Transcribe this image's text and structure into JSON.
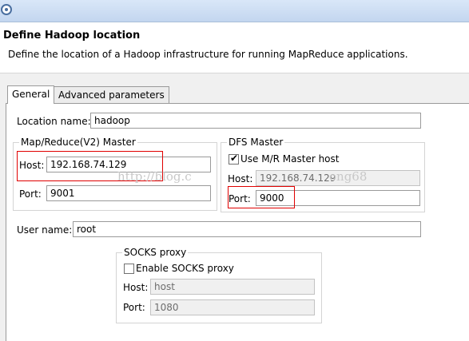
{
  "header": {
    "title": "Define Hadoop location",
    "description": "Define the location of a Hadoop infrastructure for running MapReduce applications."
  },
  "tabs": [
    {
      "label": "General",
      "active": true
    },
    {
      "label": "Advanced parameters",
      "active": false
    }
  ],
  "general": {
    "location_name_label": "Location name:",
    "location_name_value": "hadoop",
    "mapreduce": {
      "title": "Map/Reduce(V2) Master",
      "host_label": "Host:",
      "host_value": "192.168.74.129",
      "port_label": "Port:",
      "port_value": "9001"
    },
    "dfs": {
      "title": "DFS Master",
      "use_mr_label": "Use M/R Master host",
      "use_mr_checked": true,
      "host_label": "Host:",
      "host_value": "192.168.74.129",
      "port_label": "Port:",
      "port_value": "9000"
    },
    "user_name_label": "User name:",
    "user_name_value": "root",
    "socks": {
      "title": "SOCKS proxy",
      "enable_label": "Enable SOCKS proxy",
      "enable_checked": false,
      "host_label": "Host:",
      "host_value": "host",
      "port_label": "Port:",
      "port_value": "1080"
    }
  },
  "watermark": "http://blog.c",
  "watermark2": "ong68",
  "colors": {
    "highlight": "#e00000",
    "titlebar": "#c3d6ef"
  }
}
